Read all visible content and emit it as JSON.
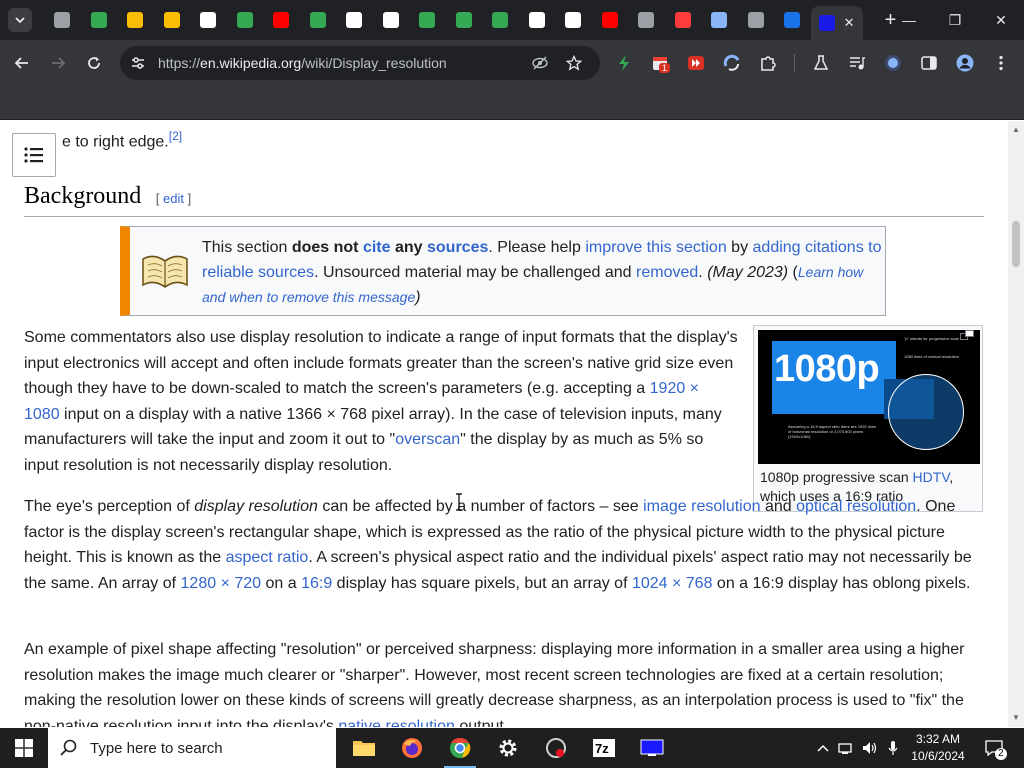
{
  "browser": {
    "url_host": "en.wikipedia.org",
    "url_path": "/wiki/Display_resolution",
    "url_scheme": "https://",
    "new_tab_label": "+",
    "window_minimize": "—",
    "window_maximize": "❐",
    "window_close": "✕",
    "active_tab_close": "✕",
    "tab_favicon_colors": [
      "#9aa0a6",
      "#34a853",
      "#fbbc04",
      "#fbbc04",
      "#ffffff",
      "#34a853",
      "#ff0000",
      "#34a853",
      "#ffffff",
      "#ffffff",
      "#34a853",
      "#34a853",
      "#34a853",
      "#ffffff",
      "#ffffff",
      "#ff0000",
      "#9aa0a6",
      "#ff3b3b",
      "#8ab4f8",
      "#9aa0a6",
      "#1a73e8"
    ],
    "extension_badge": "1"
  },
  "article": {
    "partial_top": "e to right edge.",
    "partial_top_ref": "[2]",
    "section_title": "Background",
    "edit_open": "[ ",
    "edit_label": "edit",
    "edit_close": " ]",
    "ambox": {
      "t1": "This section ",
      "b1": "does not",
      "l1": "cite",
      "b2": "any",
      "l2": "sources",
      "t2": ". Please help ",
      "l3": "improve this section",
      "t3": " by ",
      "l4": "adding citations to reliable sources",
      "t4": ". Unsourced material may be challenged and ",
      "l5": "removed",
      "t5": ".",
      "date": "(May 2023)",
      "t6": " (",
      "l6": "Learn how and when to remove this message",
      "t7": ")"
    },
    "figure": {
      "big_label": "1080p",
      "caption_text": "1080p progressive scan ",
      "caption_link": "HDTV",
      "caption_rest": ", which uses a 16:9 ratio",
      "note_1": "\"p\" stands for progressive scan",
      "note_2": "1080 lines of vertical resolution",
      "note_3": "Assuming a 16:9 aspect ratio there are 1920 lines of horizontal resolution or 2,073,600 pixels (1920x1080)"
    },
    "p1": {
      "t1": "Some commentators also use display resolution to indicate a range of input formats that the display's input electronics will accept and often include formats greater than the screen's native grid size even though they have to be down-scaled to match the screen's parameters (e.g. accepting a ",
      "l1": "1920 × 1080",
      "t2": " input on a display with a native 1366 × 768 pixel array). In the case of television inputs, many manufacturers will take the input and zoom it out to \"",
      "l2": "overscan",
      "t3": "\" the display by as much as 5% so input resolution is not necessarily display resolution."
    },
    "p2": {
      "t1": "The eye's perception of ",
      "i1": "display resolution",
      "t2": " can be affected by a number of factors – see ",
      "l1": "image resolution",
      "t3": " and ",
      "l2": "optical resolution",
      "t4": ". One factor is the display screen's rectangular shape, which is expressed as the ratio of the physical picture width to the physical picture height. This is known as the ",
      "l3": "aspect ratio",
      "t5": ". A screen's physical aspect ratio and the individual pixels' aspect ratio may not necessarily be the same. An array of ",
      "l4": "1280 × 720",
      "t6": " on a ",
      "l5": "16:9",
      "t7": " display has square pixels, but an array of ",
      "l6": "1024 × 768",
      "t8": " on a 16:9 display has oblong pixels."
    },
    "p3": {
      "t1": "An example of pixel shape affecting \"resolution\" or perceived sharpness: displaying more information in a smaller area using a higher resolution makes the image much clearer or \"sharper\". However, most recent screen technologies are fixed at a certain resolution; making the resolution lower on these kinds of screens will greatly decrease sharpness, as an interpolation process is used to \"fix\" the non-native resolution input into the display's ",
      "l1": "native resolution",
      "t2": " output."
    }
  },
  "taskbar": {
    "search_placeholder": "Type here to search",
    "time": "3:32 AM",
    "date": "10/6/2024",
    "notification_count": "2"
  }
}
